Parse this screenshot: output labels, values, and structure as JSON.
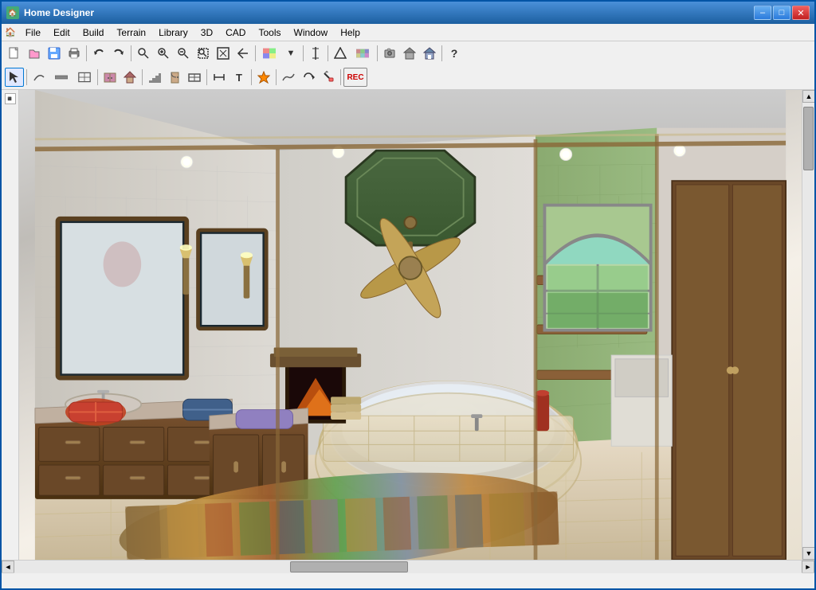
{
  "window": {
    "title": "Home Designer",
    "controls": {
      "minimize": "–",
      "maximize": "□",
      "close": "✕"
    }
  },
  "menubar": {
    "items": [
      "File",
      "Edit",
      "Build",
      "Terrain",
      "Library",
      "3D",
      "CAD",
      "Tools",
      "Window",
      "Help"
    ]
  },
  "toolbar1": {
    "buttons": [
      {
        "name": "new",
        "icon": "📄",
        "label": "New"
      },
      {
        "name": "open",
        "icon": "📂",
        "label": "Open"
      },
      {
        "name": "save",
        "icon": "💾",
        "label": "Save"
      },
      {
        "name": "print",
        "icon": "🖨",
        "label": "Print"
      },
      {
        "name": "undo",
        "icon": "↩",
        "label": "Undo"
      },
      {
        "name": "redo",
        "icon": "↪",
        "label": "Redo"
      },
      {
        "name": "find",
        "icon": "🔍",
        "label": "Find"
      },
      {
        "name": "zoom-in",
        "icon": "+🔍",
        "label": "Zoom In"
      },
      {
        "name": "zoom-out",
        "icon": "-🔍",
        "label": "Zoom Out"
      },
      {
        "name": "zoom-box",
        "icon": "⊞",
        "label": "Zoom Box"
      },
      {
        "name": "fill-window",
        "icon": "⤢",
        "label": "Fill Window"
      },
      {
        "name": "zoom-reset",
        "icon": "↺",
        "label": "Zoom Reset"
      },
      {
        "name": "materials",
        "icon": "🎨",
        "label": "Materials"
      },
      {
        "name": "arrow-down",
        "icon": "▼",
        "label": "Arrow"
      },
      {
        "name": "measure",
        "icon": "|",
        "label": "Measure"
      },
      {
        "name": "elevation",
        "icon": "▲",
        "label": "Elevation"
      },
      {
        "name": "texture",
        "icon": "▦",
        "label": "Texture"
      },
      {
        "name": "3d-view",
        "icon": "🏠",
        "label": "3D View"
      },
      {
        "name": "help",
        "icon": "?",
        "label": "Help"
      },
      {
        "name": "camera1",
        "icon": "📷",
        "label": "Camera 1"
      },
      {
        "name": "camera2",
        "icon": "🏠",
        "label": "Camera 2"
      },
      {
        "name": "camera3",
        "icon": "🏠",
        "label": "Camera 3"
      }
    ]
  },
  "toolbar2": {
    "buttons": [
      {
        "name": "select",
        "icon": "↖",
        "label": "Select"
      },
      {
        "name": "poly-line",
        "icon": "⌒",
        "label": "Poly Line"
      },
      {
        "name": "wall-types",
        "icon": "▭",
        "label": "Wall Types"
      },
      {
        "name": "room",
        "icon": "⬜",
        "label": "Room"
      },
      {
        "name": "cabinet",
        "icon": "▦",
        "label": "Cabinet"
      },
      {
        "name": "roof",
        "icon": "△",
        "label": "Roof"
      },
      {
        "name": "stairs",
        "icon": "⬆",
        "label": "Stairs"
      },
      {
        "name": "door",
        "icon": "🚪",
        "label": "Door"
      },
      {
        "name": "window-tool",
        "icon": "⊟",
        "label": "Window"
      },
      {
        "name": "dimension",
        "icon": "⟺",
        "label": "Dimension"
      },
      {
        "name": "text",
        "icon": "T",
        "label": "Text"
      },
      {
        "name": "symbol",
        "icon": "★",
        "label": "Symbol"
      },
      {
        "name": "terrain",
        "icon": "〜",
        "label": "Terrain"
      },
      {
        "name": "rotate",
        "icon": "↻",
        "label": "Rotate"
      },
      {
        "name": "paint",
        "icon": "🖌",
        "label": "Paint"
      },
      {
        "name": "rec",
        "icon": "REC",
        "label": "Record"
      }
    ]
  },
  "viewport": {
    "scene_description": "3D rendered bathroom interior with ceiling fan, bathtub, vanity, shelves, window, and rug"
  },
  "statusbar": {
    "text": ""
  }
}
